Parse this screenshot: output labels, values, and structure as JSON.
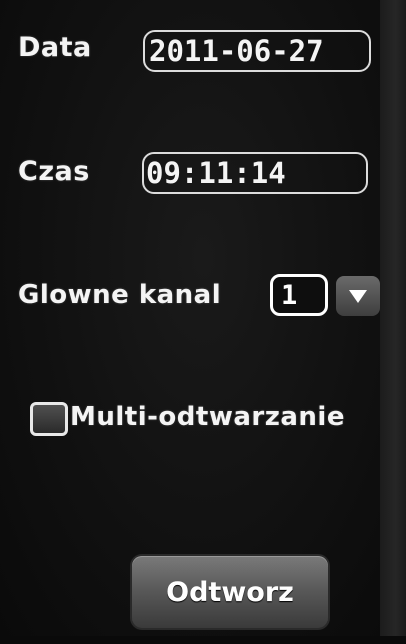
{
  "form": {
    "date_label": "Data",
    "date_value": "2011-06-27",
    "time_label": "Czas",
    "time_value": "09:11:14",
    "channel_label": "Glowne kanal",
    "channel_value": "1",
    "multi_label": "Multi-odtwarzanie",
    "multi_checked": false
  },
  "actions": {
    "play_label": "Odtworz"
  },
  "icons": {
    "dropdown": "triangle-down-icon"
  },
  "colors": {
    "background": "#111111",
    "text": "#f4f4f4",
    "field_border": "#dcdcdc",
    "button": "#5a5a5a"
  }
}
